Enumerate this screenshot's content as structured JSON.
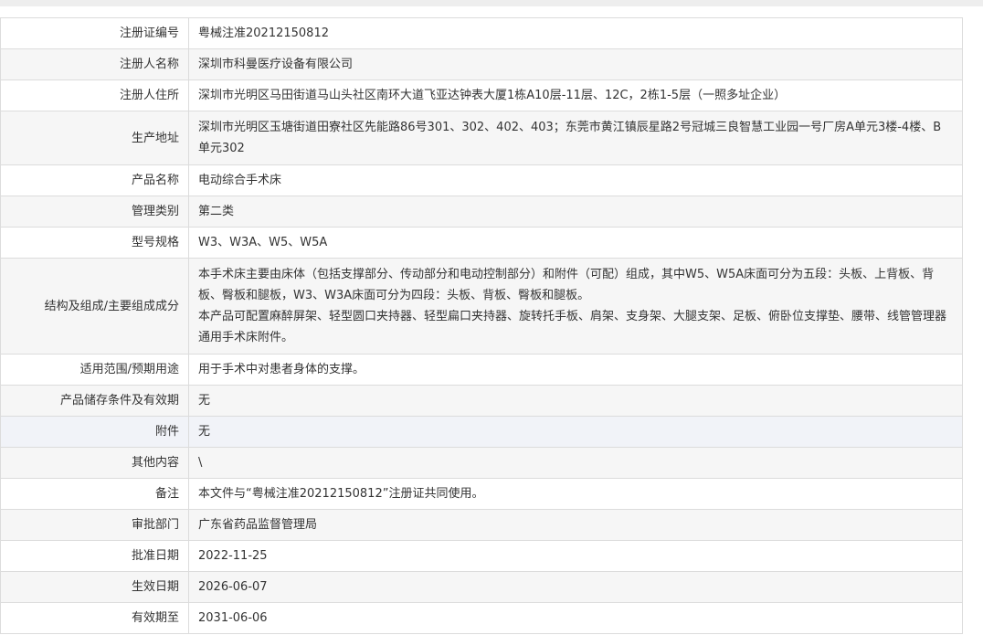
{
  "rows": [
    {
      "label": "注册证编号",
      "value": "粤械注准20212150812"
    },
    {
      "label": "注册人名称",
      "value": "深圳市科曼医疗设备有限公司"
    },
    {
      "label": "注册人住所",
      "value": "深圳市光明区马田街道马山头社区南环大道飞亚达钟表大厦1栋A10层-11层、12C，2栋1-5层（一照多址企业）"
    },
    {
      "label": "生产地址",
      "value": "深圳市光明区玉塘街道田寮社区先能路86号301、302、402、403；东莞市黄江镇辰星路2号冠城三良智慧工业园一号厂房A单元3楼-4楼、B单元302"
    },
    {
      "label": "产品名称",
      "value": "电动综合手术床"
    },
    {
      "label": "管理类别",
      "value": "第二类"
    },
    {
      "label": "型号规格",
      "value": "W3、W3A、W5、W5A"
    },
    {
      "label": "结构及组成/主要组成成分",
      "value_paragraphs": [
        "本手术床主要由床体（包括支撑部分、传动部分和电动控制部分）和附件（可配）组成，其中W5、W5A床面可分为五段：头板、上背板、背板、臀板和腿板，W3、W3A床面可分为四段：头板、背板、臀板和腿板。",
        "本产品可配置麻醉屏架、轻型圆口夹持器、轻型扁口夹持器、旋转托手板、肩架、支身架、大腿支架、足板、俯卧位支撑垫、腰带、线管管理器通用手术床附件。"
      ]
    },
    {
      "label": "适用范围/预期用途",
      "value": "用于手术中对患者身体的支撑。"
    },
    {
      "label": "产品储存条件及有效期",
      "value": "无"
    },
    {
      "label": "附件",
      "value": "无"
    },
    {
      "label": "其他内容",
      "value": "\\"
    },
    {
      "label": "备注",
      "value": "本文件与“粤械注准20212150812”注册证共同使用。"
    },
    {
      "label": "审批部门",
      "value": "广东省药品监督管理局"
    },
    {
      "label": "批准日期",
      "value": "2022-11-25"
    },
    {
      "label": "生效日期",
      "value": "2026-06-07"
    },
    {
      "label": "有效期至",
      "value": "2031-06-06"
    }
  ]
}
